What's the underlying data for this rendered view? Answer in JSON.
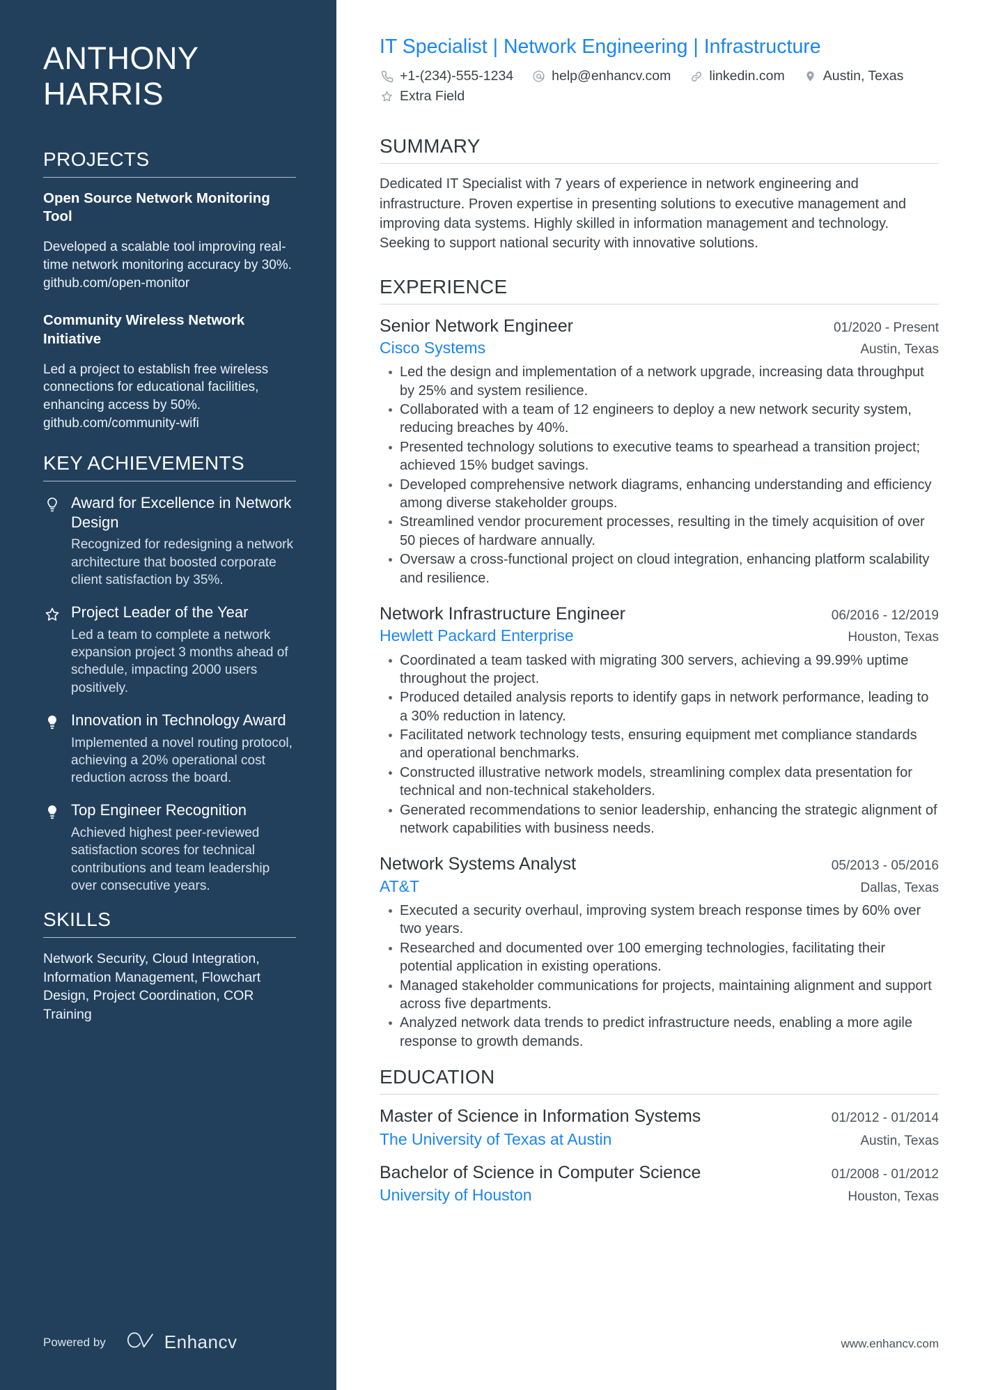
{
  "theme": {
    "sidebar_bg": "#22405c",
    "accent_blue": "#1b85f3",
    "text_dark": "#32383d"
  },
  "sidebar": {
    "name_first": "ANTHONY",
    "name_last": "HARRIS",
    "projects": {
      "heading": "PROJECTS",
      "items": [
        {
          "title": "Open Source Network Monitoring Tool",
          "description": "Developed a scalable tool improving real-time network monitoring accuracy by 30%. github.com/open-monitor"
        },
        {
          "title": "Community Wireless Network Initiative",
          "description": "Led a project to establish free wireless connections for educational facilities, enhancing access by 50%. github.com/community-wifi"
        }
      ]
    },
    "achievements": {
      "heading": "KEY ACHIEVEMENTS",
      "items": [
        {
          "icon": "lightbulb-outline-icon",
          "title": "Award for Excellence in Network Design",
          "description": "Recognized for redesigning a network architecture that boosted corporate client satisfaction by 35%."
        },
        {
          "icon": "star-outline-icon",
          "title": "Project Leader of the Year",
          "description": "Led a team to complete a network expansion project 3 months ahead of schedule, impacting 2000 users positively."
        },
        {
          "icon": "lightbulb-filled-icon",
          "title": "Innovation in Technology Award",
          "description": "Implemented a novel routing protocol, achieving a 20% operational cost reduction across the board."
        },
        {
          "icon": "lightbulb-filled-icon",
          "title": "Top Engineer Recognition",
          "description": "Achieved highest peer-reviewed satisfaction scores for technical contributions and team leadership over consecutive years."
        }
      ]
    },
    "skills": {
      "heading": "SKILLS",
      "text": "Network Security, Cloud Integration, Information Management, Flowchart Design, Project Coordination, COR Training"
    },
    "footer": {
      "powered_by": "Powered by",
      "brand": "Enhancv"
    }
  },
  "main": {
    "headline": "IT Specialist | Network Engineering | Infrastructure",
    "contacts_row1": [
      {
        "icon": "phone-icon",
        "text": "+1-(234)-555-1234"
      },
      {
        "icon": "email-icon",
        "text": "help@enhancv.com"
      },
      {
        "icon": "link-icon",
        "text": "linkedin.com"
      },
      {
        "icon": "location-pin-icon",
        "text": "Austin, Texas"
      }
    ],
    "contacts_row2": [
      {
        "icon": "star-outline-icon",
        "text": "Extra Field"
      }
    ],
    "summary": {
      "heading": "SUMMARY",
      "text": "Dedicated IT Specialist with 7 years of experience in network engineering and infrastructure. Proven expertise in presenting solutions to executive management and improving data systems. Highly skilled in information management and technology. Seeking to support national security with innovative solutions."
    },
    "experience": {
      "heading": "EXPERIENCE",
      "jobs": [
        {
          "title": "Senior Network Engineer",
          "date": "01/2020 - Present",
          "company": "Cisco Systems",
          "location": "Austin, Texas",
          "bullets": [
            "Led the design and implementation of a network upgrade, increasing data throughput by 25% and system resilience.",
            "Collaborated with a team of 12 engineers to deploy a new network security system, reducing breaches by 40%.",
            "Presented technology solutions to executive teams to spearhead a transition project; achieved 15% budget savings.",
            "Developed comprehensive network diagrams, enhancing understanding and efficiency among diverse stakeholder groups.",
            "Streamlined vendor procurement processes, resulting in the timely acquisition of over 50 pieces of hardware annually.",
            "Oversaw a cross-functional project on cloud integration, enhancing platform scalability and resilience."
          ]
        },
        {
          "title": "Network Infrastructure Engineer",
          "date": "06/2016 - 12/2019",
          "company": "Hewlett Packard Enterprise",
          "location": "Houston, Texas",
          "bullets": [
            "Coordinated a team tasked with migrating 300 servers, achieving a 99.99% uptime throughout the project.",
            "Produced detailed analysis reports to identify gaps in network performance, leading to a 30% reduction in latency.",
            "Facilitated network technology tests, ensuring equipment met compliance standards and operational benchmarks.",
            "Constructed illustrative network models, streamlining complex data presentation for technical and non-technical stakeholders.",
            "Generated recommendations to senior leadership, enhancing the strategic alignment of network capabilities with business needs."
          ]
        },
        {
          "title": "Network Systems Analyst",
          "date": "05/2013 - 05/2016",
          "company": "AT&T",
          "location": "Dallas, Texas",
          "bullets": [
            "Executed a security overhaul, improving system breach response times by 60% over two years.",
            "Researched and documented over 100 emerging technologies, facilitating their potential application in existing operations.",
            "Managed stakeholder communications for projects, maintaining alignment and support across five departments.",
            "Analyzed network data trends to predict infrastructure needs, enabling a more agile response to growth demands."
          ]
        }
      ]
    },
    "education": {
      "heading": "EDUCATION",
      "entries": [
        {
          "degree": "Master of Science in Information Systems",
          "date": "01/2012 - 01/2014",
          "school": "The University of Texas at Austin",
          "location": "Austin, Texas"
        },
        {
          "degree": "Bachelor of Science in Computer Science",
          "date": "01/2008 - 01/2012",
          "school": "University of Houston",
          "location": "Houston, Texas"
        }
      ]
    },
    "footer_url": "www.enhancv.com"
  }
}
